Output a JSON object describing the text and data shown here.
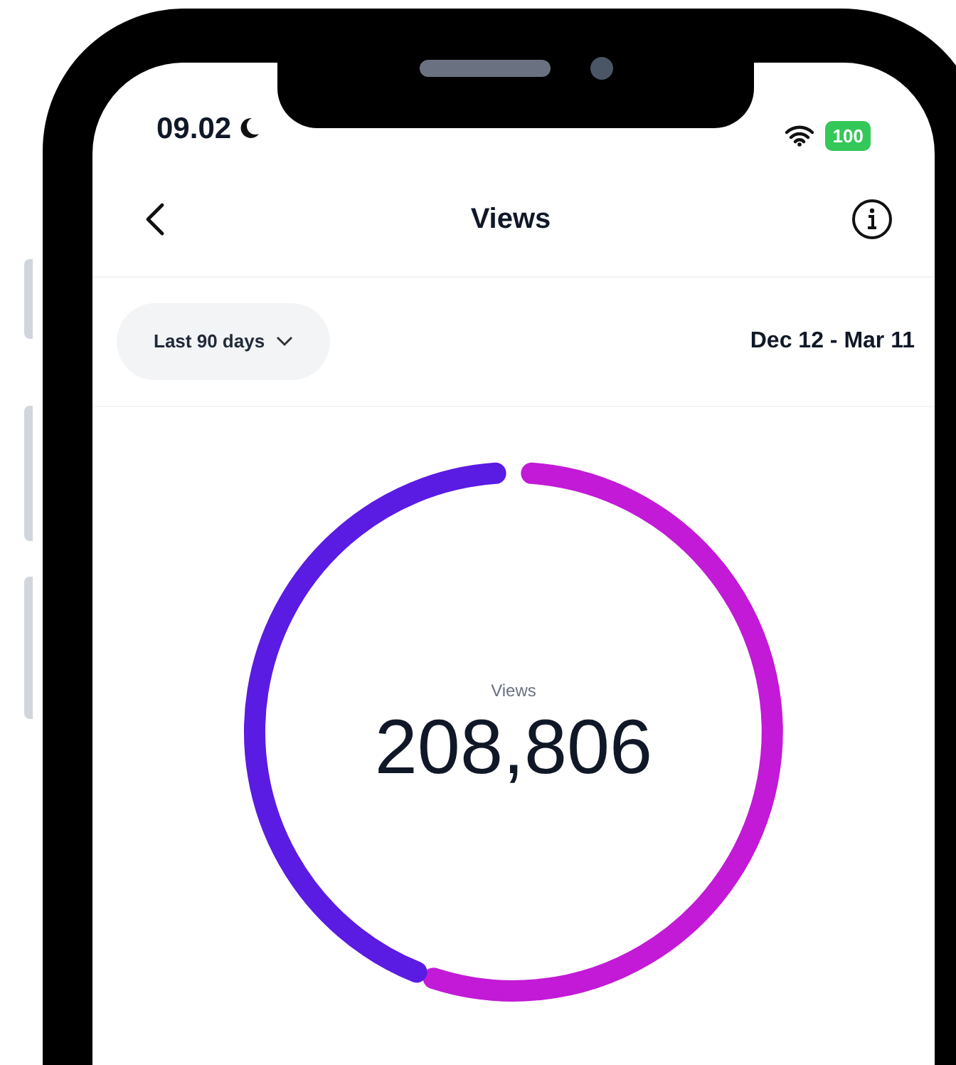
{
  "status_bar": {
    "time": "09.02",
    "battery": "100"
  },
  "header": {
    "title": "Views"
  },
  "filter": {
    "label": "Last 90 days"
  },
  "date_range": "Dec 12 - Mar 11",
  "metric": {
    "label": "Views",
    "value": "208,806"
  }
}
